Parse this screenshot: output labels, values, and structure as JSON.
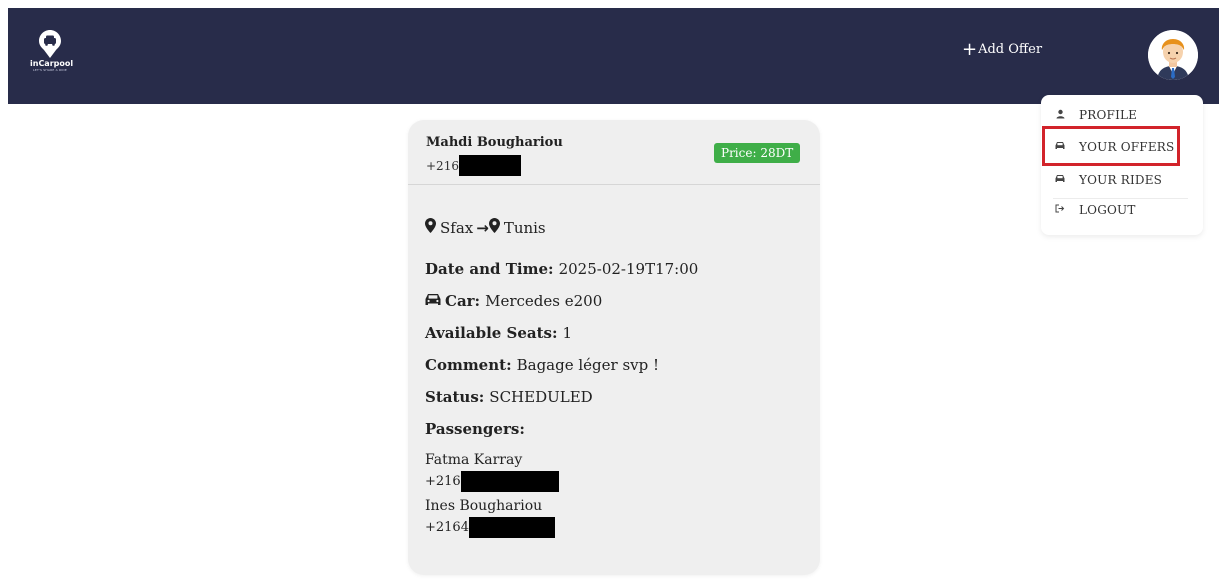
{
  "brand": {
    "name": "inCarpool",
    "tagline": "LET'S SHARE A RIDE",
    "icon": "car-pin-logo",
    "bg_color": "#282c4a"
  },
  "nav": {
    "add_offer_icon": "plus-icon",
    "add_offer_label": "Add Offer",
    "avatar": "user-avatar"
  },
  "menu": {
    "items": [
      {
        "icon": "user-icon",
        "label": "PROFILE"
      },
      {
        "icon": "car-icon",
        "label": "YOUR OFFERS",
        "highlighted": true
      },
      {
        "icon": "car-icon",
        "label": "YOUR RIDES"
      },
      {
        "icon": "logout-icon",
        "label": "LOGOUT"
      }
    ],
    "highlight_color": "#d2232a"
  },
  "offer": {
    "driver_name": "Mahdi Boughariou",
    "driver_phone_prefix": "+216",
    "price": "Price: 28DT",
    "price_color": "#3fae48",
    "from": "Sfax",
    "to": "Tunis",
    "route_arrow": "→",
    "datetime_label": "Date and Time:",
    "datetime_value": "2025-02-19T17:00",
    "car_label": "Car:",
    "car_value": "Mercedes e200",
    "seats_label": "Available Seats:",
    "seats_value": "1",
    "comment_label": "Comment:",
    "comment_value": "Bagage léger svp !",
    "status_label": "Status:",
    "status_value": "SCHEDULED",
    "passengers_label": "Passengers:",
    "passengers": [
      {
        "name": "Fatma Karray",
        "phone_prefix": "+216"
      },
      {
        "name": "Ines Boughariou",
        "phone_prefix": "+2164"
      }
    ]
  }
}
